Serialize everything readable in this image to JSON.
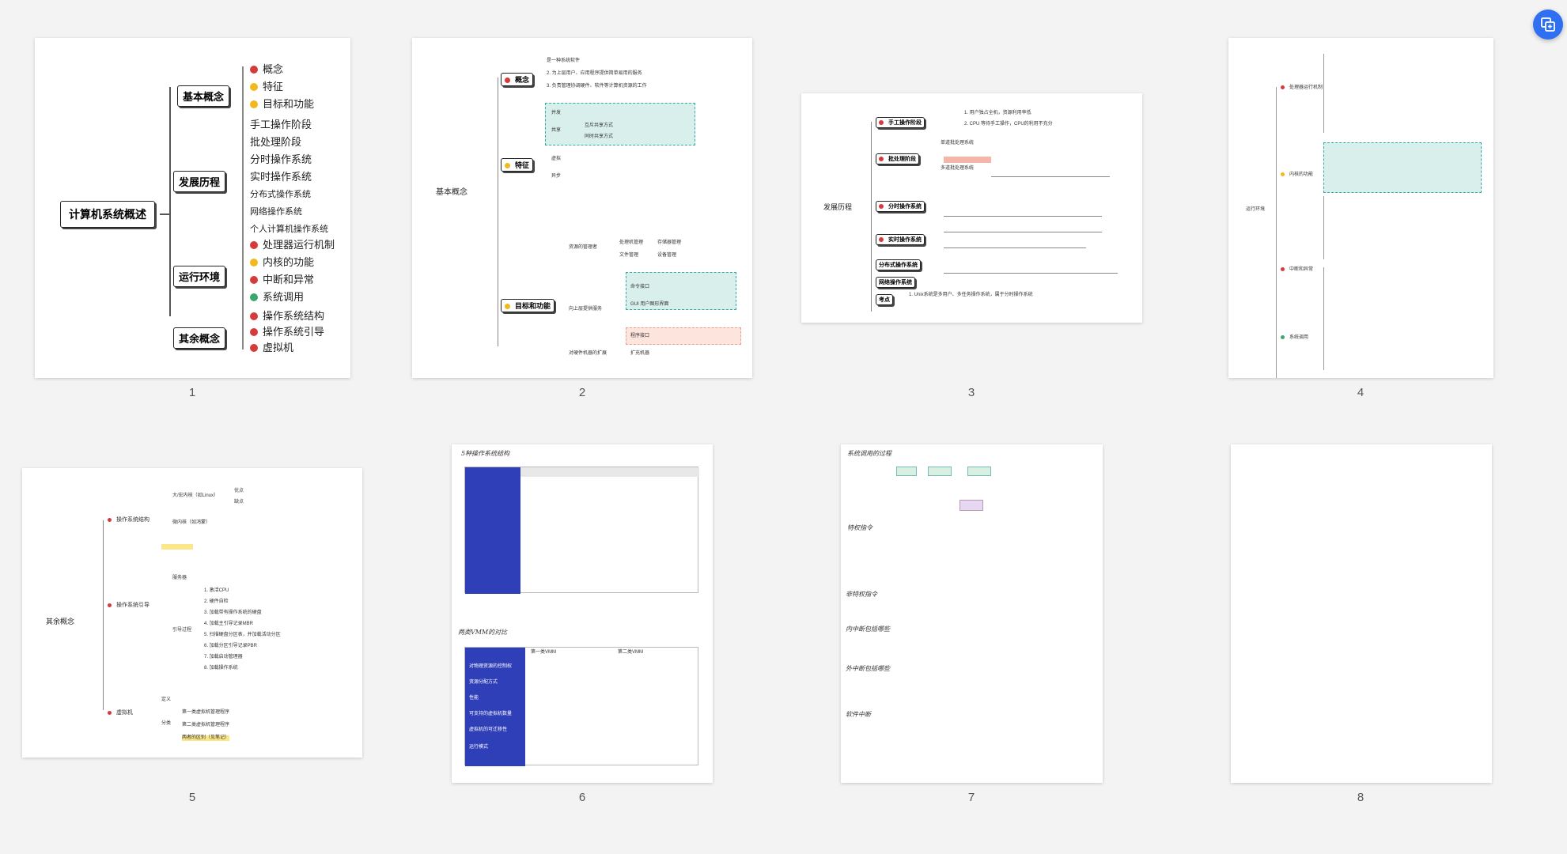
{
  "toolbar": {
    "grid_view_icon": "grid-view-icon"
  },
  "pages": [
    {
      "number": "1"
    },
    {
      "number": "2"
    },
    {
      "number": "3"
    },
    {
      "number": "4"
    },
    {
      "number": "5"
    },
    {
      "number": "6"
    },
    {
      "number": "7"
    },
    {
      "number": "8"
    }
  ],
  "page1": {
    "root": "计算机系统概述",
    "branches": [
      "基本概念",
      "发展历程",
      "运行环境",
      "其余概念"
    ],
    "items_basic": [
      "概念",
      "特征",
      "目标和功能"
    ],
    "items_history": [
      "手工操作阶段",
      "批处理阶段",
      "分时操作系统",
      "实时操作系统",
      "分布式操作系统",
      "网络操作系统",
      "个人计算机操作系统"
    ],
    "items_env": [
      "处理器运行机制",
      "内核的功能",
      "中断和异常",
      "系统调用"
    ],
    "items_other": [
      "操作系统结构",
      "操作系统引导",
      "虚拟机"
    ]
  },
  "page2": {
    "root": "基本概念",
    "branches": [
      "概念",
      "特征",
      "目标和功能"
    ],
    "concept_items": [
      "是一种系统软件",
      "2. 为上层用户、应用程序提供简单易用的服务",
      "3. 负责管理协调硬件、软件等计算机资源的工作"
    ],
    "feature_items": [
      "并发",
      "共享",
      "虚拟",
      "异步"
    ],
    "share_items": [
      "互斥共享方式",
      "同时共享方式"
    ],
    "func_items": [
      "资源的管理者",
      "向上层提供服务",
      "对硬件机器的扩展"
    ],
    "labels": [
      "处理机管理",
      "存储器管理",
      "文件管理",
      "设备管理",
      "命令接口",
      "GUI 用户图形界面",
      "程序接口",
      "扩充机器"
    ]
  },
  "page3": {
    "root": "发展历程",
    "branches": [
      "手工操作阶段",
      "批处理阶段",
      "分时操作系统",
      "实时操作系统",
      "分布式操作系统",
      "网络操作系统",
      "考点"
    ],
    "notes": [
      "1. 用户独占全机，资源利用率低",
      "2. CPU 等待手工操作，CPU的利用不充分",
      "单道批处理系统",
      "多道批处理系统",
      "1. Unix系统是多用户、多任务操作系统，属于分时操作系统"
    ]
  },
  "page4": {
    "root": "运行环境",
    "branches": [
      "处理器运行机制",
      "内核的功能",
      "中断和异常",
      "系统调用"
    ]
  },
  "page5": {
    "root": "其余概念",
    "branches": [
      "操作系统结构",
      "操作系统引导",
      "虚拟机"
    ],
    "items": [
      "大/宏内核（如Linux）",
      "微内核（如鸿蒙）",
      "服务器",
      "引导过程",
      "定义",
      "分类"
    ],
    "notes": [
      "优点",
      "缺点",
      "1. 激活CPU",
      "2. 硬件自检",
      "3. 加载带有操作系统的硬盘",
      "4. 加载主引导记录MBR",
      "5. 扫描硬盘分区表，并加载活动分区",
      "6. 加载分区引导记录PBR",
      "7. 加载启动管理器",
      "8. 加载操作系统",
      "第一类虚拟机管理程序",
      "第二类虚拟机管理程序"
    ],
    "highlight": "两者的区别（见笔记）"
  },
  "page6": {
    "title1": "5种操作系统结构",
    "title2": "两类VMM的对比",
    "table_header": [
      "",
      "第一类VMM",
      "第二类VMM"
    ],
    "table_rows": [
      "对物理资源的控制权",
      "资源分配方式",
      "性能",
      "可支持的虚拟机数量",
      "虚拟机的可迁移性",
      "运行模式"
    ]
  },
  "page7": {
    "title": "系统调用的过程",
    "sections": [
      "特权指令",
      "非特权指令",
      "内中断包括哪些",
      "外中断包括哪些",
      "软件中断"
    ]
  },
  "colors": {
    "accent": "#2f6ff2",
    "teal": "#2a9d8f",
    "red": "#d63b3b",
    "yellow": "#f2b81c",
    "green": "#3aa76d"
  }
}
